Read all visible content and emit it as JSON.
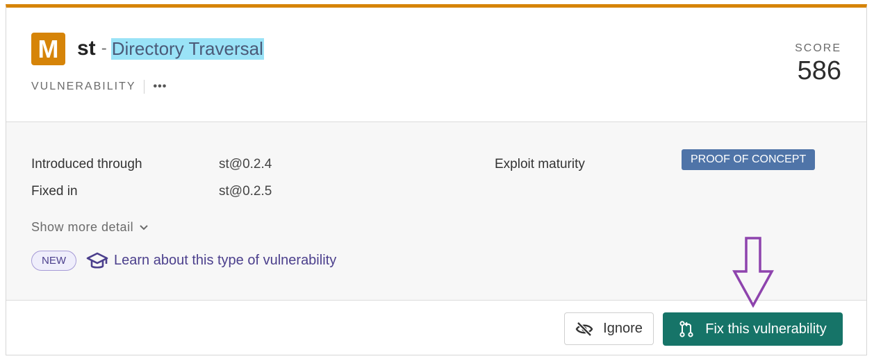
{
  "header": {
    "severity_letter": "M",
    "package": "st",
    "separator": "-",
    "vulnerability_title": "Directory Traversal",
    "type_label": "VULNERABILITY",
    "more_label": "•••",
    "score_label": "SCORE",
    "score_value": "586"
  },
  "details": {
    "introduced_label": "Introduced through",
    "introduced_value": "st@0.2.4",
    "fixed_label": "Fixed in",
    "fixed_value": "st@0.2.5",
    "exploit_label": "Exploit maturity",
    "exploit_badge": "PROOF OF CONCEPT",
    "show_more": "Show more detail",
    "new_badge": "NEW",
    "learn_link": "Learn about this type of vulnerability"
  },
  "footer": {
    "ignore_label": "Ignore",
    "fix_label": "Fix this vulnerability"
  },
  "colors": {
    "accent": "#d68408",
    "fix_button": "#167468",
    "badge": "#4f74a8",
    "learn": "#4b3f8c",
    "highlight": "#9ae3f7",
    "annotation_arrow": "#8e44ad"
  },
  "icons": {
    "show_more": "chevron-down-icon",
    "learn": "graduation-cap-icon",
    "ignore": "eye-slash-icon",
    "fix": "pull-request-icon",
    "annotation": "down-arrow-icon"
  }
}
